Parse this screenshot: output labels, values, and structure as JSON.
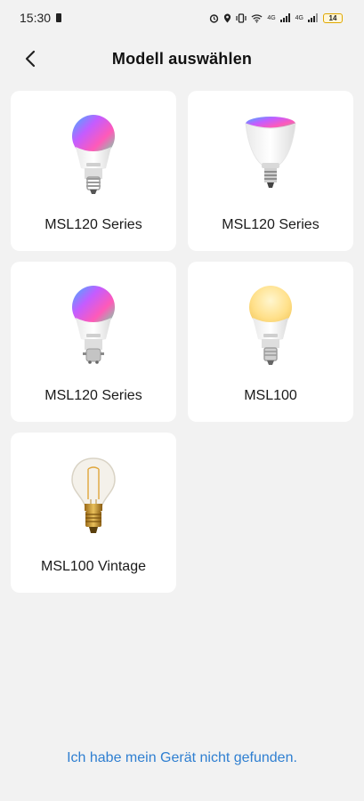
{
  "status_bar": {
    "time": "15:30",
    "battery_level": "14",
    "network_label_1": "4G",
    "network_label_2": "4G"
  },
  "header": {
    "title": "Modell auswählen"
  },
  "models": [
    {
      "label": "MSL120 Series",
      "bulb": "rgb-a19-e27"
    },
    {
      "label": "MSL120 Series",
      "bulb": "rgb-br30-flood"
    },
    {
      "label": "MSL120 Series",
      "bulb": "rgb-a19-b22"
    },
    {
      "label": "MSL100",
      "bulb": "warm-white-a19"
    },
    {
      "label": "MSL100 Vintage",
      "bulb": "filament-vintage"
    }
  ],
  "footer": {
    "link_text": "Ich habe mein Gerät nicht gefunden."
  },
  "colors": {
    "background": "#f2f2f2",
    "card": "#ffffff",
    "link": "#2f7fd1"
  }
}
